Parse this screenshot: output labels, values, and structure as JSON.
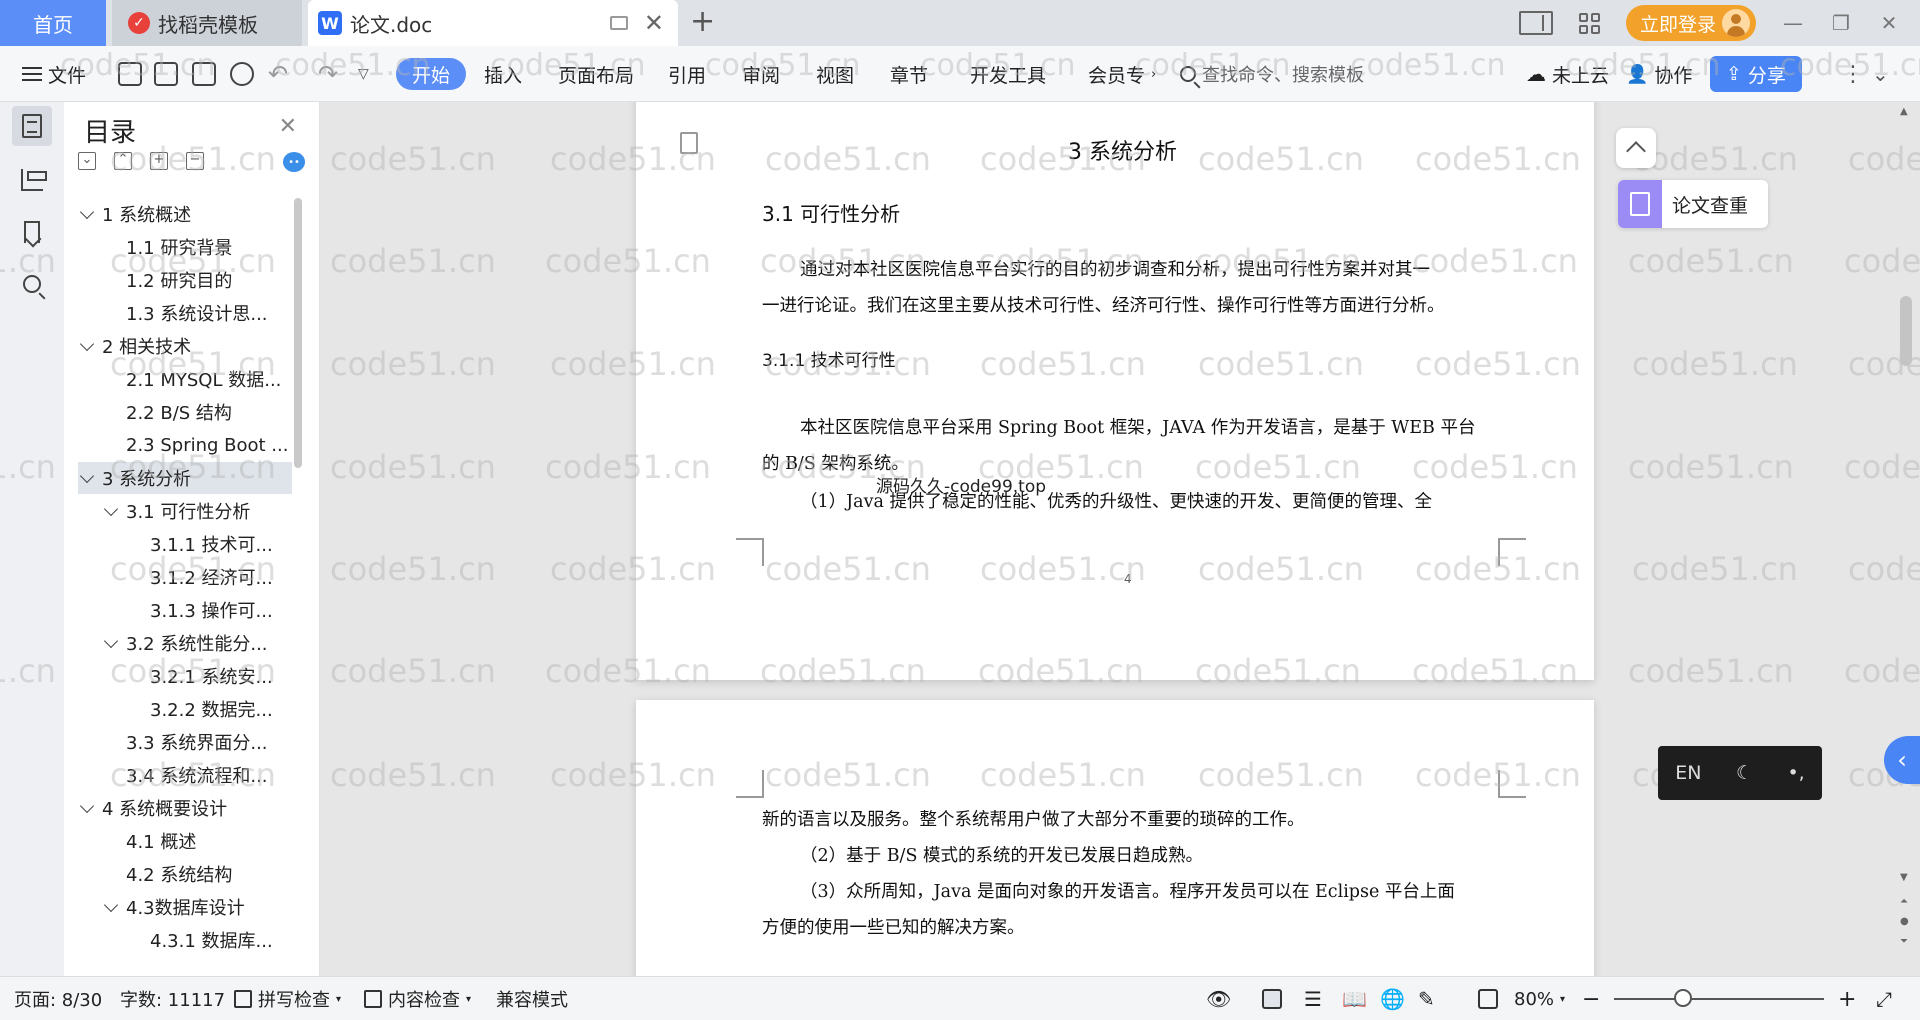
{
  "tabs": {
    "home": "首页",
    "template": "找稻壳模板",
    "document": "论文.doc"
  },
  "window": {
    "login": "立即登录"
  },
  "toolbar": {
    "file": "文件",
    "menus": [
      "开始",
      "插入",
      "页面布局",
      "引用",
      "审阅",
      "视图",
      "章节",
      "开发工具",
      "会员专"
    ],
    "search_placeholder": "查找命令、搜索模板",
    "cloud": "未上云",
    "collab": "协作",
    "share": "分享"
  },
  "toc": {
    "title": "目录",
    "items": [
      {
        "label": "1 系统概述",
        "level": 1,
        "expanded": true
      },
      {
        "label": "1.1  研究背景",
        "level": 2
      },
      {
        "label": "1.2 研究目的",
        "level": 2
      },
      {
        "label": "1.3 系统设计思...",
        "level": 2
      },
      {
        "label": "2 相关技术",
        "level": 1,
        "expanded": true
      },
      {
        "label": "2.1 MYSQL 数据...",
        "level": 2
      },
      {
        "label": "2.2 B/S 结构",
        "level": 2
      },
      {
        "label": "2.3 Spring Boot ...",
        "level": 2
      },
      {
        "label": "3 系统分析",
        "level": 1,
        "expanded": true,
        "selected": true
      },
      {
        "label": "3.1 可行性分析",
        "level": 2,
        "expanded": true
      },
      {
        "label": "3.1.1 技术可...",
        "level": 3
      },
      {
        "label": "3.1.2 经济可...",
        "level": 3
      },
      {
        "label": "3.1.3 操作可...",
        "level": 3
      },
      {
        "label": "3.2 系统性能分...",
        "level": 2,
        "expanded": true
      },
      {
        "label": "3.2.1  系统安...",
        "level": 3
      },
      {
        "label": "3.2.2  数据完...",
        "level": 3
      },
      {
        "label": "3.3 系统界面分...",
        "level": 2
      },
      {
        "label": "3.4 系统流程和...",
        "level": 2
      },
      {
        "label": "4 系统概要设计",
        "level": 1,
        "expanded": true
      },
      {
        "label": "4.1 概述",
        "level": 2
      },
      {
        "label": "4.2 系统结构",
        "level": 2
      },
      {
        "label": "4.3数据库设计",
        "level": 2,
        "expanded": true
      },
      {
        "label": "4.3.1 数据库...",
        "level": 3
      }
    ]
  },
  "document": {
    "chapter_title": "3 系统分析",
    "section_title": "3.1 可行性分析",
    "intro_line1": "通过对本社区医院信息平台实行的目的初步调查和分析，提出可行性方案并对其一",
    "intro_line2": "一进行论证。我们在这里主要从技术可行性、经济可行性、操作可行性等方面进行分析。",
    "subsection_title": "3.1.1 技术可行性",
    "tech_line1": "本社区医院信息平台采用 Spring Boot 框架，JAVA 作为开发语言，是基于 WEB 平台",
    "tech_line2": "的 B/S 架构系统。",
    "point1": "（1）Java 提供了稳定的性能、优秀的升级性、更快速的开发、更简便的管理、全",
    "overlay": "源码久久-code99.top",
    "page_number": "4",
    "p2_line1": "新的语言以及服务。整个系统帮用户做了大部分不重要的琐碎的工作。",
    "p2_line2": "（2）基于 B/S 模式的系统的开发已发展日趋成熟。",
    "p2_line3": "（3）众所周知，Java 是面向对象的开发语言。程序开发员可以在 Eclipse 平台上面",
    "p2_line4": "方便的使用一些已知的解决方案。"
  },
  "watermark": "code51.cn",
  "right_panel": {
    "check": "论文查重",
    "ime_lang": "EN"
  },
  "status": {
    "page": "页面: 8/30",
    "words": "字数: 11117",
    "spell": "拼写检查",
    "content_check": "内容检查",
    "compat": "兼容模式",
    "zoom": "80%",
    "zoom_level": 0.33
  }
}
